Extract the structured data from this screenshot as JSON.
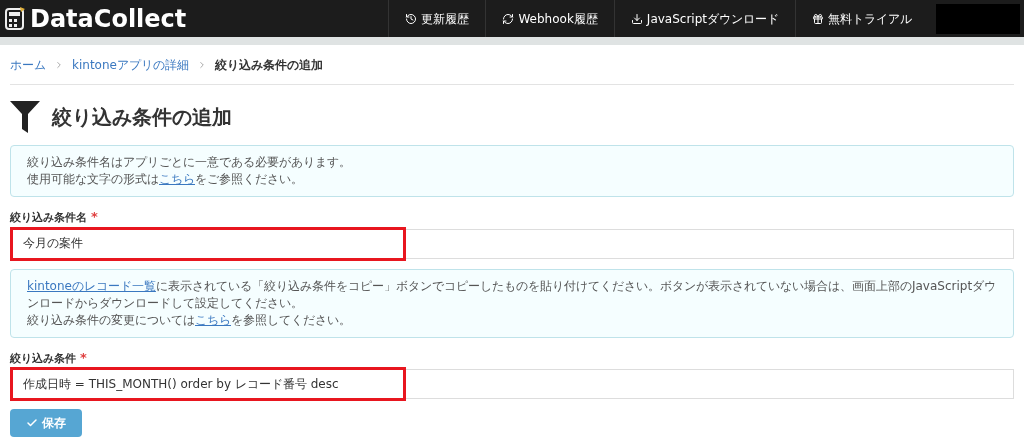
{
  "header": {
    "logo": "DataCollect",
    "nav": [
      {
        "kind": "history",
        "label": "更新履歴"
      },
      {
        "kind": "sync",
        "label": "Webhook履歴"
      },
      {
        "kind": "download",
        "label": "JavaScriptダウンロード"
      },
      {
        "kind": "gift",
        "label": "無料トライアル"
      }
    ]
  },
  "breadcrumb": [
    {
      "label": "ホーム",
      "link": true
    },
    {
      "label": "kintoneアプリの詳細",
      "link": true
    },
    {
      "label": "絞り込み条件の追加",
      "link": false
    }
  ],
  "title": "絞り込み条件の追加",
  "fields": [
    {
      "notice": [
        [
          {
            "text": "絞り込み条件名はアプリごとに一意である必要があります。",
            "link": false
          }
        ],
        [
          {
            "text": "使用可能な文字の形式は",
            "link": false
          },
          {
            "text": "こちら",
            "link": true
          },
          {
            "text": "をご参照ください。",
            "link": false
          }
        ]
      ],
      "label": "絞り込み条件名",
      "required_mark": "*",
      "value": "今月の案件",
      "highlighted": true
    },
    {
      "notice": [
        [
          {
            "text": "kintoneのレコード一覧",
            "link": true
          },
          {
            "text": "に表示されている「絞り込み条件をコピー」ボタンでコピーしたものを貼り付けてください。ボタンが表示されていない場合は、画面上部のJavaScriptダウンロードからダウンロードして設定してください。",
            "link": false
          }
        ],
        [
          {
            "text": "絞り込み条件の変更については",
            "link": false
          },
          {
            "text": "こちら",
            "link": true
          },
          {
            "text": "を参照してください。",
            "link": false
          }
        ]
      ],
      "label": "絞り込み条件",
      "required_mark": "*",
      "value": "作成日時 = THIS_MONTH() order by レコード番号 desc",
      "highlighted": true
    }
  ],
  "save_button": "保存"
}
